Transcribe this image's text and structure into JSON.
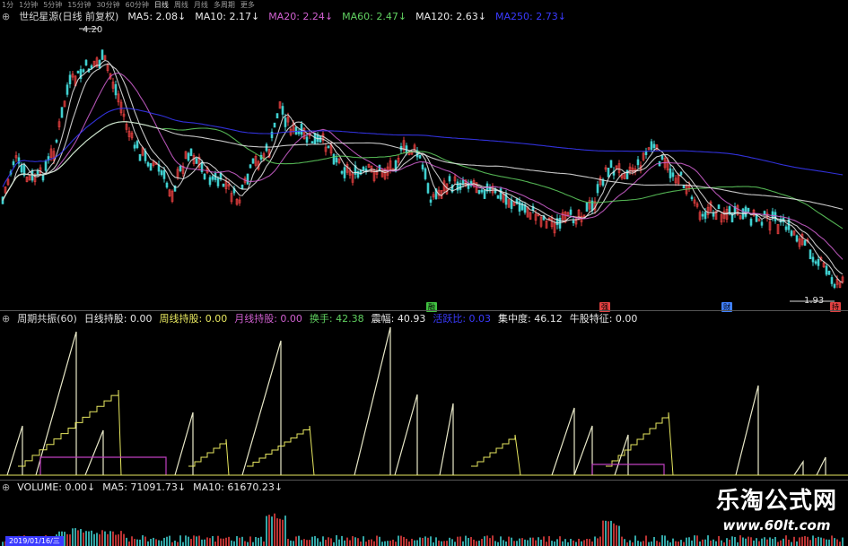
{
  "periods": [
    "1分",
    "1分钟",
    "5分钟",
    "15分钟",
    "30分钟",
    "60分钟",
    "日线",
    "周线",
    "月线",
    "多周期",
    "更多"
  ],
  "active_period": "日线",
  "header": {
    "stock": "世纪星源(日线 前复权)",
    "ma": [
      {
        "label": "MA5: 2.08↓",
        "color": "#e8e8e8"
      },
      {
        "label": "MA10: 2.17↓",
        "color": "#e8e8e8"
      },
      {
        "label": "MA20: 2.24↓",
        "color": "#d060d0"
      },
      {
        "label": "MA60: 2.47↓",
        "color": "#60d060"
      },
      {
        "label": "MA120: 2.63↓",
        "color": "#e8e8e8"
      },
      {
        "label": "MA250: 2.73↓",
        "color": "#3a3aff"
      }
    ]
  },
  "price": {
    "high": "4.20",
    "low": "1.93"
  },
  "markers": [
    {
      "text": "融",
      "color": "#40c040"
    },
    {
      "text": "强",
      "color": "#e04040"
    },
    {
      "text": "财",
      "color": "#4080ff"
    },
    {
      "text": "持",
      "color": "#e04040"
    }
  ],
  "indicator": {
    "name": "周期共振(60)",
    "items": [
      {
        "label": "日线持股: 0.00",
        "color": "#e8e8e8"
      },
      {
        "label": "周线持股: 0.00",
        "color": "#e8e860"
      },
      {
        "label": "月线持股: 0.00",
        "color": "#d060d0"
      },
      {
        "label": "换手: 42.38",
        "color": "#60d060"
      },
      {
        "label": "震幅: 40.93",
        "color": "#e8e8e8"
      },
      {
        "label": "活跃比: 0.03",
        "color": "#3a3aff"
      },
      {
        "label": "集中度: 46.12",
        "color": "#e8e8e8"
      },
      {
        "label": "牛股特征: 0.00",
        "color": "#e8e8e8"
      }
    ]
  },
  "volume": {
    "items": [
      {
        "label": "VOLUME: 0.00↓",
        "color": "#e8e8e8"
      },
      {
        "label": "MA5: 71091.73↓",
        "color": "#e8e8e8"
      },
      {
        "label": "MA10: 61670.23↓",
        "color": "#e8e8e8"
      }
    ]
  },
  "date": "2019/01/16/三",
  "watermark": {
    "cn": "乐淘公式网",
    "url": "www.60lt.com"
  }
}
